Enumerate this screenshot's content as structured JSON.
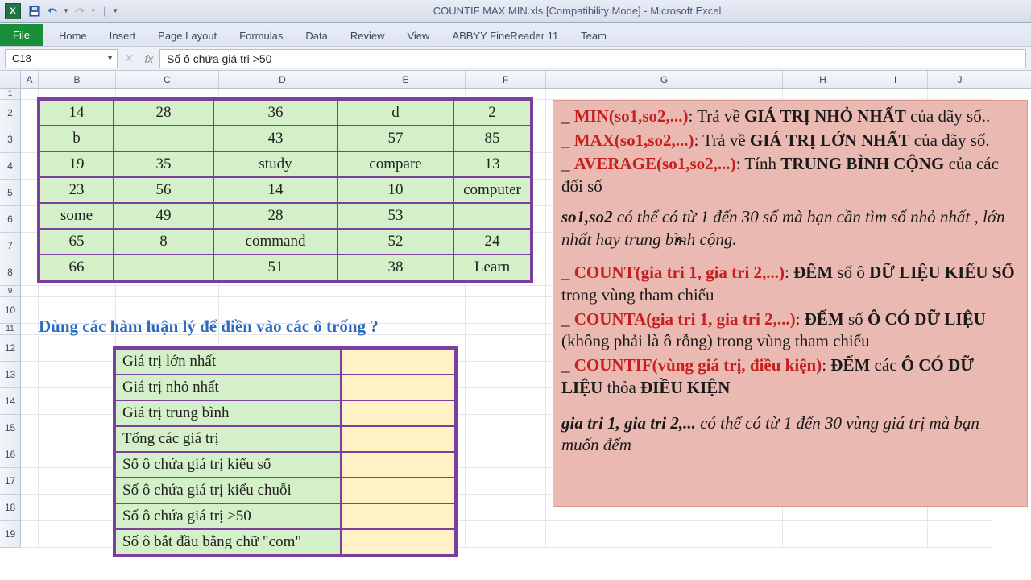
{
  "titlebar": {
    "title": "COUNTIF MAX MIN.xls  [Compatibility Mode]  -  Microsoft Excel"
  },
  "ribbon": {
    "file": "File",
    "tabs": [
      "Home",
      "Insert",
      "Page Layout",
      "Formulas",
      "Data",
      "Review",
      "View",
      "ABBYY FineReader 11",
      "Team"
    ]
  },
  "formula_bar": {
    "name_box": "C18",
    "fx_label": "fx",
    "formula": "Số ô chứa giá trị >50"
  },
  "columns": [
    "A",
    "B",
    "C",
    "D",
    "E",
    "F",
    "G",
    "H",
    "I",
    "J"
  ],
  "row_numbers": [
    "1",
    "2",
    "3",
    "4",
    "5",
    "6",
    "7",
    "8",
    "9",
    "10",
    "11",
    "12",
    "13",
    "14",
    "15",
    "16",
    "17",
    "18",
    "19"
  ],
  "data_table": [
    [
      "14",
      "28",
      "36",
      "d",
      "2"
    ],
    [
      "b",
      "",
      "43",
      "57",
      "85"
    ],
    [
      "19",
      "35",
      "study",
      "compare",
      "13"
    ],
    [
      "23",
      "56",
      "14",
      "10",
      "computer"
    ],
    [
      "some",
      "49",
      "28",
      "53",
      ""
    ],
    [
      "65",
      "8",
      "command",
      "52",
      "24"
    ],
    [
      "66",
      "",
      "51",
      "38",
      "Learn"
    ]
  ],
  "question": "Dùng các hàm luận lý để điền vào các ô trống ?",
  "answers": [
    "Giá trị lớn nhất",
    "Giá trị nhỏ nhất",
    "Giá trị trung bình",
    "Tổng các giá trị",
    "Số ô chứa giá trị kiểu số",
    "Số ô chứa giá trị kiểu chuỗi",
    "Số ô chứa giá trị >50",
    "Số ô bắt đầu bằng chữ \"com\""
  ],
  "notes": {
    "l1a": "_ ",
    "l1b": "MIN(so1,so2,...)",
    "l1c": ":  Trả về ",
    "l1d": "GIÁ TRỊ NHỎ NHẤT",
    "l1e": " của dãy số..",
    "l2a": "_ ",
    "l2b": "MAX(so1,so2,...)",
    "l2c": ":  Trả về ",
    "l2d": "GIÁ TRỊ LỚN NHẤT",
    "l2e": " của dãy số.",
    "l3a": "_ ",
    "l3b": "AVERAGE(",
    "l3c": "so1,so2,...",
    "l3d": ")",
    "l3e": ":  Tính ",
    "l3f": "TRUNG BÌNH CỘNG",
    "l3g": " của các đối số",
    "l4a": "so1,so2",
    "l4b": " có thể có từ 1 đến 30 số mà bạn cần tìm số nhỏ nhất , lớn nhất hay trung bình cộng.",
    "l5a": "_ ",
    "l5b": "COUNT(gia tri 1, gia tri 2,...)",
    "l5c": ": ",
    "l5d": "ĐẾM",
    "l5e": " số ô ",
    "l5f": "DỮ LIỆU KIỂU SỐ",
    "l5g": " trong vùng tham chiếu",
    "l6a": "_ ",
    "l6b": "COUNTA(gia tri 1, gia tri 2,...)",
    "l6c": ": ",
    "l6d": "ĐẾM",
    "l6e": " số ",
    "l6f": "Ô CÓ DỮ LIỆU",
    "l6g": " (không phải là ô rỗng) trong vùng tham chiếu",
    "l7a": "_ ",
    "l7b": "COUNTIF(vùng giá trị, điều kiện)",
    "l7c": ": ",
    "l7d": "ĐẾM",
    "l7e": " các ",
    "l7f": "Ô CÓ DỮ LIỆU",
    "l7g": " thỏa ",
    "l7h": "ĐIỀU KIỆN",
    "l8a": "gia tri 1, gia tri 2,...",
    "l8b": " có thể có từ 1 đến 30 vùng giá trị mà bạn muốn đếm"
  }
}
